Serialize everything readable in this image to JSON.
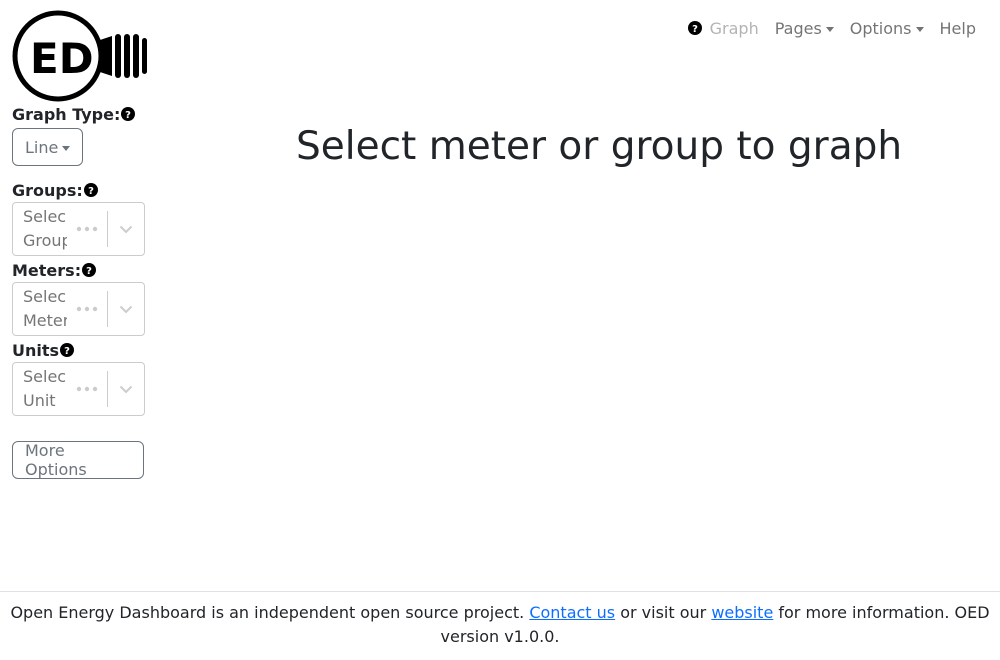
{
  "logo": {
    "text": "ED"
  },
  "nav": {
    "graph_label": "Graph",
    "pages_label": "Pages",
    "options_label": "Options",
    "help_label": "Help"
  },
  "sidebar": {
    "graph_type_label": "Graph Type:",
    "graph_type_value": "Line",
    "groups_label": "Groups:",
    "groups_placeholder_1": "Selec",
    "groups_placeholder_2": "Group",
    "meters_label": "Meters:",
    "meters_placeholder_1": "Selec",
    "meters_placeholder_2": "Meter",
    "units_label": "Units",
    "units_placeholder_1": "Selec",
    "units_placeholder_2": "Unit",
    "more_options_label": "More Options"
  },
  "main": {
    "title": "Select meter or group to graph"
  },
  "footer": {
    "text_1": "Open Energy Dashboard is an independent open source project. ",
    "contact_link": "Contact us",
    "text_2": " or visit our ",
    "website_link": "website",
    "text_3": " for more information. OED version v1.0.0."
  },
  "colors": {
    "link": "#0d6efd",
    "outline": "#6c757d"
  }
}
